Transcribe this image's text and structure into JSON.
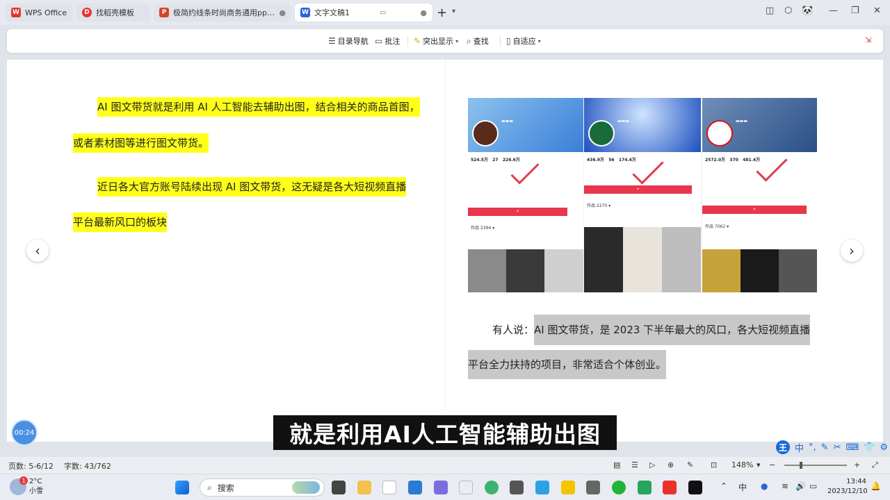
{
  "tabs": [
    {
      "label": "WPS Office",
      "icon": "wps-logo-icon",
      "color": "#e8332b"
    },
    {
      "label": "找稻壳模板",
      "icon": "docer-icon",
      "color": "#e8332b"
    },
    {
      "label": "极简约线条时尚商务通用ppt模板",
      "icon": "ppt-icon",
      "color": "#d24726"
    },
    {
      "label": "文字文稿1",
      "icon": "word-icon",
      "color": "#2b65d9"
    }
  ],
  "toolbar": {
    "toc_nav": "目录导航",
    "comment": "批注",
    "highlight": "突出显示",
    "find": "查找",
    "adaptive": "自适应"
  },
  "doc": {
    "left_para1_line1": "AI 图文带货就是利用 AI 人工智能去辅助出图，结合相关的商品首图，",
    "left_para1_line2": "或者素材图等进行图文带货。",
    "left_para2_line1": "近日各大官方账号陆续出现 AI 图文带货，这无疑是各大短视频直播",
    "left_para2_line2": "平台最新风口的板块",
    "right_para_prefix": "有人说：",
    "right_para_line1": "AI 图文带货，是 2023 下半年最大的风口，各大短视频直播",
    "right_para_line2": "平台全力扶持的项目，非常适合个体创业。"
  },
  "subtitle": "就是利用AI人工智能辅助出图",
  "timer": "00:24",
  "status": {
    "page": "页数: 5-6/12",
    "words": "字数: 43/762",
    "zoom": "148%"
  },
  "ime": {
    "cap": "王",
    "mode": "中"
  },
  "taskbar": {
    "weather_temp": "2°C",
    "weather_desc": "小雪",
    "weather_badge": "1",
    "search": "搜索",
    "tray_lang": "中",
    "time": "13:44",
    "date": "2023/12/10"
  },
  "colors": {
    "highlight_yellow": "#ffff1a",
    "highlight_gray": "#c8c8c8",
    "accent_blue": "#1a6ad6",
    "brand_red": "#e8332b"
  }
}
